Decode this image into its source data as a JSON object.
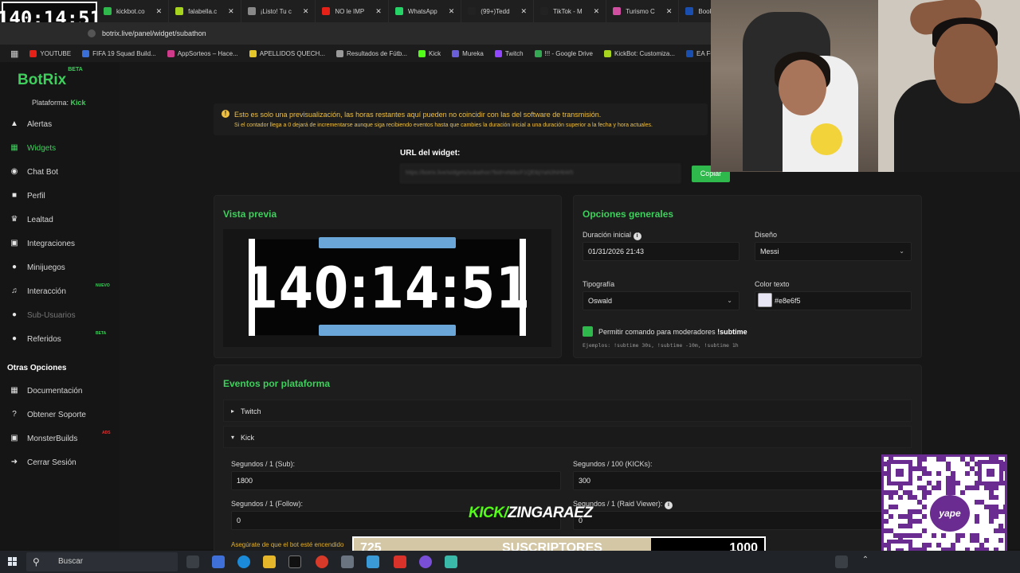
{
  "overlay_timer": "140:14:51",
  "browser": {
    "tabs": [
      {
        "label": "kickbot.co",
        "color": "#2fb84c"
      },
      {
        "label": "falabella.c",
        "color": "#a6d41f"
      },
      {
        "label": "¡Listo! Tu c",
        "color": "#888888"
      },
      {
        "label": "NO le IMP",
        "color": "#e62117"
      },
      {
        "label": "WhatsApp",
        "color": "#25d366"
      },
      {
        "label": "(99+)Tedd",
        "color": "#222222"
      },
      {
        "label": "TikTok - M",
        "color": "#222222"
      },
      {
        "label": "Turismo C",
        "color": "#d04fa0"
      },
      {
        "label": "Booking.co",
        "color": "#1a4fb0"
      }
    ],
    "url": "botrix.live/panel/widget/subathon",
    "bookmarks": [
      {
        "label": "YOUTUBE",
        "color": "#e62117"
      },
      {
        "label": "FIFA 19 Squad Build...",
        "color": "#3a6fd8"
      },
      {
        "label": "AppSorteos – Hace...",
        "color": "#d03a8a"
      },
      {
        "label": "APELLIDOS QUECH...",
        "color": "#e6c72a"
      },
      {
        "label": "Resultados de Fútb...",
        "color": "#999999"
      },
      {
        "label": "Kick",
        "color": "#53fc18"
      },
      {
        "label": "Mureka",
        "color": "#6a5fd8"
      },
      {
        "label": "Twitch",
        "color": "#9146ff"
      },
      {
        "label": "!!! - Google Drive",
        "color": "#34a853"
      },
      {
        "label": "KickBot: Customiza...",
        "color": "#a6d41f"
      },
      {
        "label": "EA FC 26 C",
        "color": "#1a4fb0"
      }
    ]
  },
  "sidebar": {
    "logo": "BotRix",
    "logo_badge": "BETA",
    "platform_label": "Plataforma:",
    "platform_value": "Kick",
    "items": [
      {
        "label": "Alertas",
        "icon": "alert-icon"
      },
      {
        "label": "Widgets",
        "icon": "widgets-icon"
      },
      {
        "label": "Chat Bot",
        "icon": "robot-icon"
      },
      {
        "label": "Perfil",
        "icon": "profile-icon"
      },
      {
        "label": "Lealtad",
        "icon": "trophy-icon"
      },
      {
        "label": "Integraciones",
        "icon": "integrations-icon"
      },
      {
        "label": "Minijuegos",
        "icon": "gamepad-icon"
      },
      {
        "label": "Interacción",
        "icon": "music-icon",
        "badge": "NUEVO"
      },
      {
        "label": "Sub-Usuarios",
        "icon": "users-icon"
      },
      {
        "label": "Referidos",
        "icon": "referrals-icon",
        "badge": "BETA"
      }
    ],
    "other_title": "Otras Opciones",
    "other_items": [
      {
        "label": "Documentación",
        "icon": "book-icon"
      },
      {
        "label": "Obtener Soporte",
        "icon": "help-icon"
      },
      {
        "label": "MonsterBuilds",
        "icon": "monitor-icon",
        "badge": "ADS"
      },
      {
        "label": "Cerrar Sesión",
        "icon": "logout-icon"
      }
    ]
  },
  "notice": {
    "line1": "Esto es solo una previsualización, las horas restantes aquí pueden no coincidir con las del software de transmisión.",
    "line2": "Si el contador llega a 0 dejará de incrementarse aunque siga recibiendo eventos hasta que cambies la duración inicial a una duración superior a la fecha y hora actuales."
  },
  "widget_url": {
    "label": "URL del widget:",
    "value": "https://botrix.live/widgets/subathon?bid=xNdxcF1QEibjYaN3NHbW5",
    "copy_label": "Copiar"
  },
  "preview": {
    "title": "Vista previa",
    "timer": "140:14:51"
  },
  "general": {
    "title": "Opciones generales",
    "initial_label": "Duración inicial",
    "initial_value": "01/31/2026 21:43",
    "design_label": "Diseño",
    "design_value": "Messi",
    "font_label": "Tipografía",
    "font_value": "Oswald",
    "color_label": "Color texto",
    "color_value": "#e8e6f5",
    "mod_label": "Permitir comando para moderadores",
    "mod_cmd": "!subtime",
    "examples": "Ejemplos: !subtime 30s, !subtime -10m, !subtime 1h"
  },
  "events": {
    "title": "Eventos por plataforma",
    "twitch": "Twitch",
    "kick": "Kick",
    "sub_label": "Segundos / 1 (Sub):",
    "sub_value": "1800",
    "kicks_label": "Segundos / 100 (KICKs):",
    "kicks_value": "300",
    "follow_label": "Segundos / 1 (Follow):",
    "follow_value": "0",
    "raid_label": "Segundos / 1 (Raid Viewer):",
    "raid_value": "0",
    "bot_note": "Asegúrate de que el bot esté encendido"
  },
  "stream_overlay": {
    "kick_prefix": "KICK/",
    "channel": "ZINGARAEZ",
    "sub_count": "725",
    "sub_label": "SUSCRIPTORES",
    "sub_goal": "1000",
    "sub_progress": 0.725,
    "qr_brand": "yape"
  },
  "taskbar": {
    "search": "Buscar"
  }
}
